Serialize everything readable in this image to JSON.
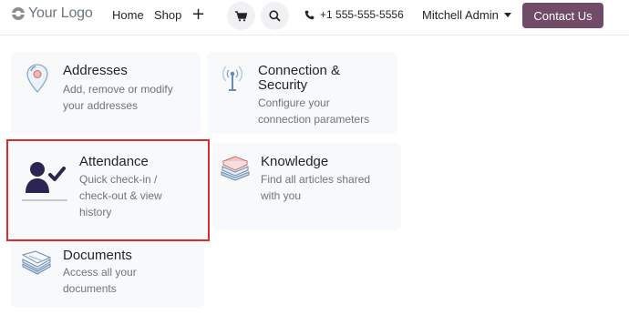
{
  "header": {
    "logo_text": "Your Logo",
    "nav": [
      {
        "label": "Home"
      },
      {
        "label": "Shop"
      }
    ],
    "plus_label": "+",
    "phone": "+1 555-555-5556",
    "user": "Mitchell Admin",
    "contact_button": "Contact Us",
    "colors": {
      "brand": "#714b67"
    }
  },
  "cards": [
    {
      "title": "Addresses",
      "description_lines": [
        "Add, remove or modify",
        "your addresses"
      ],
      "icon": "map-pin-icon"
    },
    {
      "title_lines": [
        "Connection &",
        "Security"
      ],
      "description_lines": [
        "Configure your",
        "connection parameters"
      ],
      "icon": "antenna-icon"
    },
    {
      "title": "Attendance",
      "description_lines": [
        "Quick check-in /",
        "check-out & view",
        "history"
      ],
      "icon": "user-check-icon",
      "highlighted": true
    },
    {
      "title": "Knowledge",
      "description_lines": [
        "Find all articles shared",
        "with you"
      ],
      "icon": "books-icon"
    },
    {
      "title": "Documents",
      "description_lines": [
        "Access all your",
        "documents"
      ],
      "icon": "document-stack-icon"
    }
  ]
}
